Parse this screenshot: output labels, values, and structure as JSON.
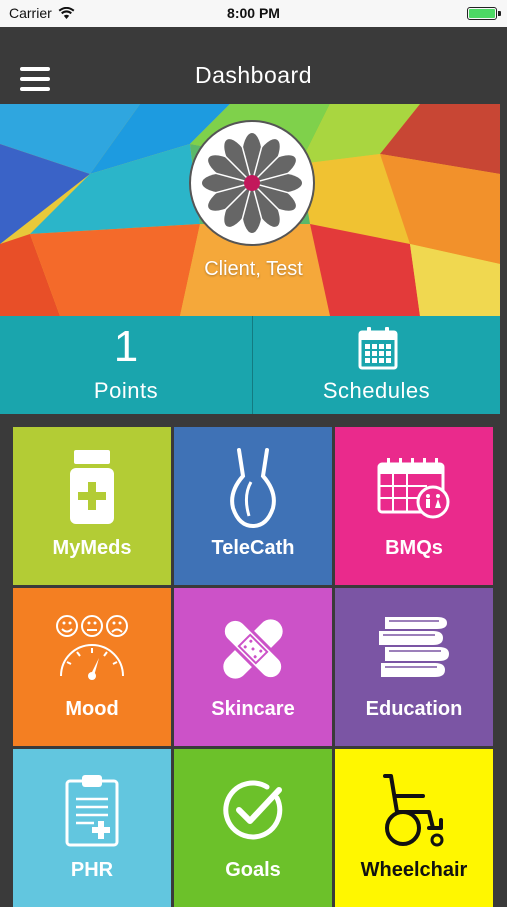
{
  "status_bar": {
    "carrier": "Carrier",
    "time": "8:00 PM",
    "battery_level": 1.0
  },
  "header": {
    "title": "Dashboard"
  },
  "profile": {
    "name": "Client, Test"
  },
  "stats": {
    "points_value": "1",
    "points_label": "Points",
    "schedules_label": "Schedules"
  },
  "tiles": [
    {
      "label": "MyMeds",
      "color": "#b3cc35",
      "icon": "medicine-bottle-icon"
    },
    {
      "label": "TeleCath",
      "color": "#3f72b6",
      "icon": "catheter-icon"
    },
    {
      "label": "BMQs",
      "color": "#ea2a8c",
      "icon": "calendar-restroom-icon"
    },
    {
      "label": "Mood",
      "color": "#f47f22",
      "icon": "mood-gauge-icon"
    },
    {
      "label": "Skincare",
      "color": "#cc52c8",
      "icon": "bandage-icon"
    },
    {
      "label": "Education",
      "color": "#7b55a4",
      "icon": "books-icon"
    },
    {
      "label": "PHR",
      "color": "#62c6df",
      "icon": "clipboard-icon"
    },
    {
      "label": "Goals",
      "color": "#6cc12a",
      "icon": "checkmark-icon"
    },
    {
      "label": "Wheelchair",
      "color": "#fff700",
      "icon": "wheelchair-icon"
    }
  ]
}
